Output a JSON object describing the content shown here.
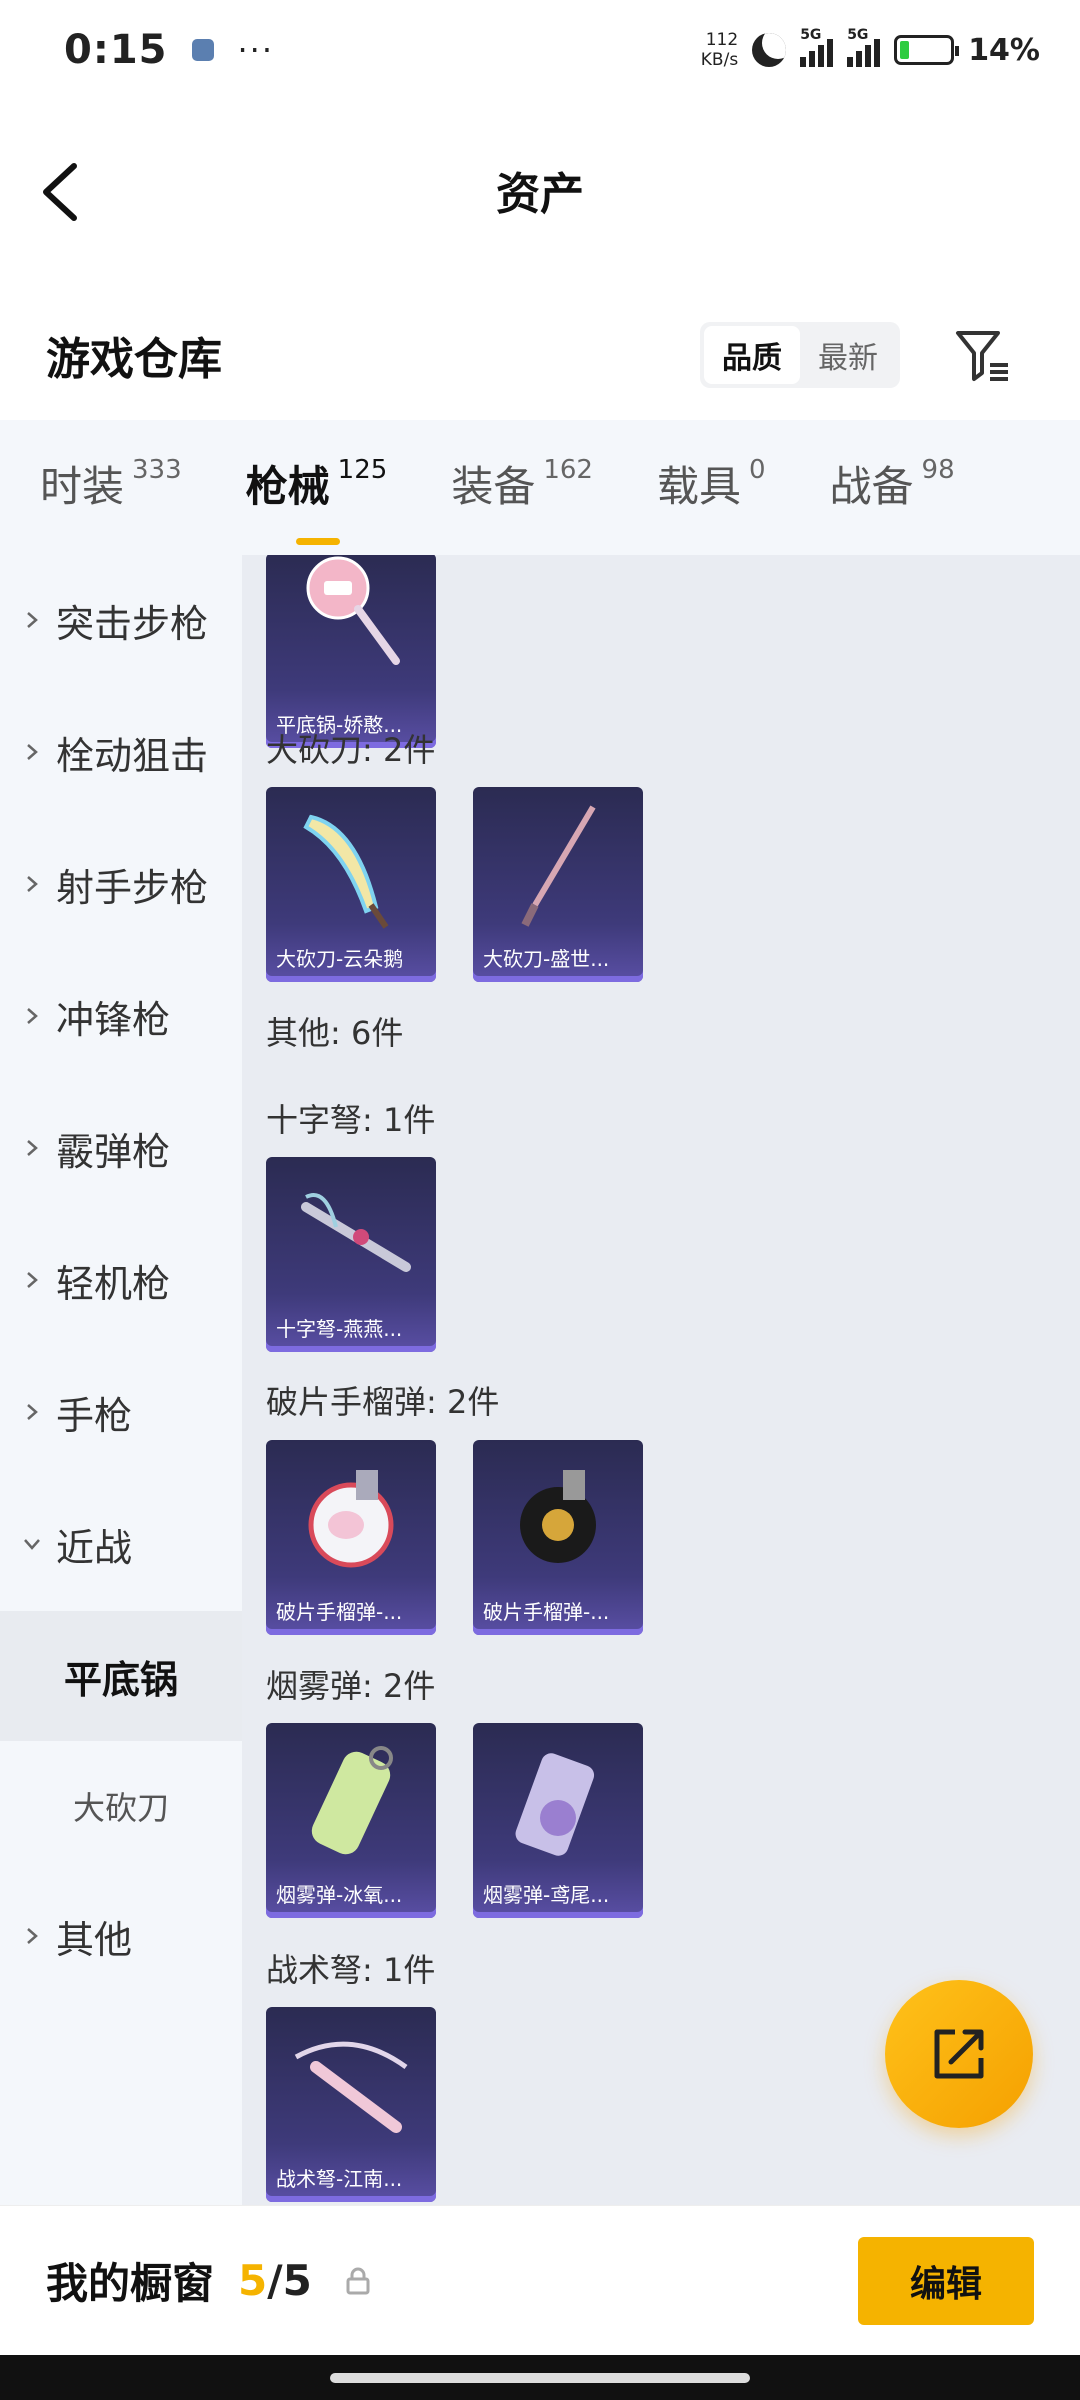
{
  "status_bar": {
    "time": "0:15",
    "more": "···",
    "net_speed_value": "112",
    "net_speed_unit": "KB/s",
    "network_1": "5G",
    "network_2": "5G",
    "battery_percent": "14%"
  },
  "header": {
    "title": "资产"
  },
  "warehouse": {
    "title": "游戏仓库",
    "sort_options": [
      "品质",
      "最新"
    ],
    "active_sort": "品质"
  },
  "tabs": [
    {
      "label": "时装",
      "count": "333"
    },
    {
      "label": "枪械",
      "count": "125",
      "active": true
    },
    {
      "label": "装备",
      "count": "162"
    },
    {
      "label": "载具",
      "count": "0"
    },
    {
      "label": "战备",
      "count": "98"
    }
  ],
  "sidebar": {
    "items": [
      "突击步枪",
      "栓动狙击",
      "射手步枪",
      "冲锋枪",
      "霰弹枪",
      "轻机枪",
      "手枪",
      "近战"
    ],
    "sub_items": [
      "平底锅",
      "大砍刀"
    ],
    "last_item": "其他"
  },
  "content": {
    "groups": [
      {
        "title": "",
        "items": [
          "平底锅-娇憨..."
        ]
      },
      {
        "title": "大砍刀: 2件",
        "items": [
          "大砍刀-云朵鹅",
          "大砍刀-盛世..."
        ]
      },
      {
        "title": "其他: 6件",
        "items": []
      },
      {
        "title": "十字弩: 1件",
        "items": [
          "十字弩-燕燕..."
        ]
      },
      {
        "title": "破片手榴弹: 2件",
        "items": [
          "破片手榴弹-...",
          "破片手榴弹-..."
        ]
      },
      {
        "title": "烟雾弹: 2件",
        "items": [
          "烟雾弹-冰氧...",
          "烟雾弹-鸢尾..."
        ]
      },
      {
        "title": "战术弩: 1件",
        "items": [
          "战术弩-江南..."
        ]
      }
    ]
  },
  "bottom_bar": {
    "label": "我的橱窗",
    "current": "5",
    "separator": "/",
    "max": "5",
    "edit_label": "编辑"
  },
  "colors": {
    "accent": "#f5b300",
    "card_bg": "#3e3a7a",
    "sidebar_bg": "#f4f7fb",
    "content_bg": "#e9ecf2"
  }
}
